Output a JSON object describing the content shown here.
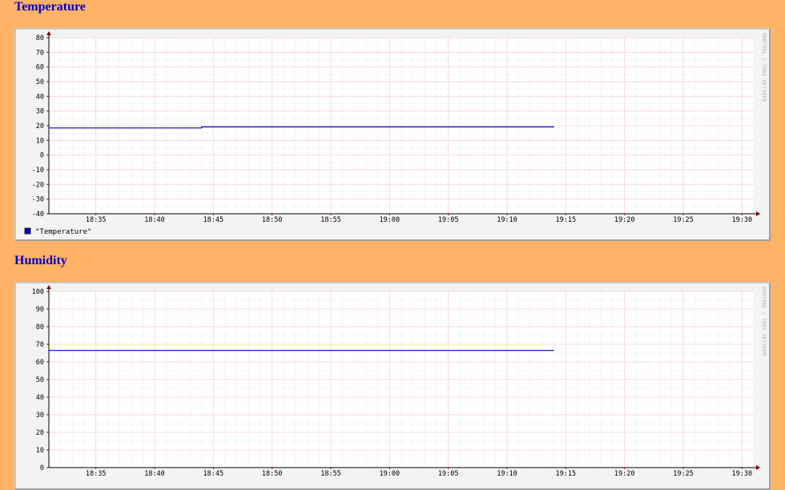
{
  "sections": [
    {
      "heading": "Temperature",
      "legend": "\"Temperature\"",
      "watermark": "RRDTOOL / TOBI OETIKER"
    },
    {
      "heading": "Humidity",
      "legend": "",
      "watermark": "RRDTOOL / TOBI OETIKER"
    }
  ],
  "chart_data": [
    {
      "type": "line",
      "title": "Temperature",
      "x_ticks": [
        "18:35",
        "18:40",
        "18:45",
        "18:50",
        "18:55",
        "19:00",
        "19:05",
        "19:10",
        "19:15",
        "19:20",
        "19:25",
        "19:30"
      ],
      "xlim": [
        "18:31",
        "19:31"
      ],
      "ylim": [
        -40,
        80
      ],
      "y_ticks": [
        -40,
        -30,
        -20,
        -10,
        0,
        10,
        20,
        30,
        40,
        50,
        60,
        70,
        80
      ],
      "grid": true,
      "series": [
        {
          "name": "\"Temperature\"",
          "color": "#0000cc",
          "x": [
            "18:31",
            "18:44",
            "18:44",
            "19:14"
          ],
          "y": [
            18.5,
            18.5,
            19.2,
            19.2
          ]
        }
      ]
    },
    {
      "type": "line",
      "title": "Humidity",
      "x_ticks": [
        "18:35",
        "18:40",
        "18:45",
        "18:50",
        "18:55",
        "19:00",
        "19:05",
        "19:10",
        "19:15",
        "19:20",
        "19:25",
        "19:30"
      ],
      "xlim": [
        "18:31",
        "19:31"
      ],
      "ylim": [
        0,
        100
      ],
      "y_ticks": [
        0,
        10,
        20,
        30,
        40,
        50,
        60,
        70,
        80,
        90,
        100
      ],
      "grid": true,
      "series": [
        {
          "color": "#0000cc",
          "x": [
            "18:31",
            "19:14"
          ],
          "y": [
            66.5,
            66.5
          ]
        }
      ]
    }
  ]
}
